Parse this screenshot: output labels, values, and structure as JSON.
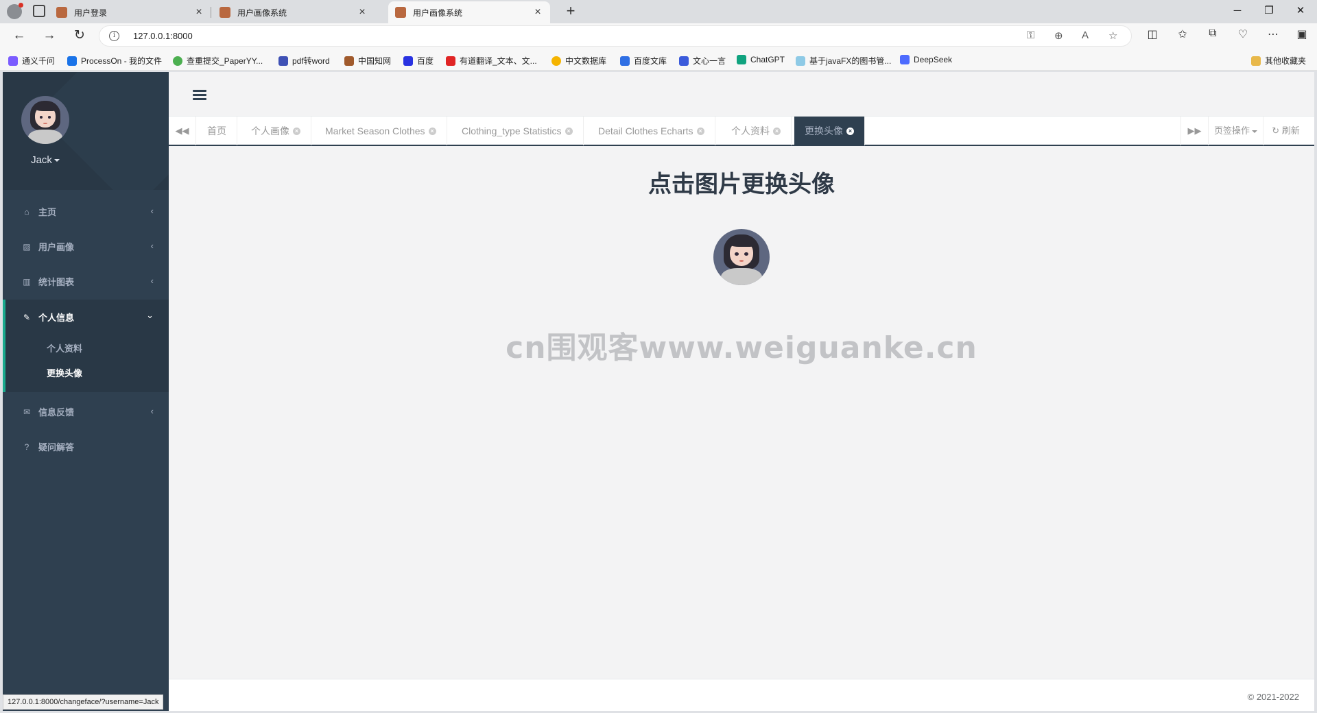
{
  "browser": {
    "tabs": [
      {
        "title": "用户登录",
        "active": false
      },
      {
        "title": "用户画像系统",
        "active": false
      },
      {
        "title": "用户画像系统",
        "active": true
      }
    ],
    "url": "127.0.0.1:8000",
    "bookmarks": [
      {
        "label": "通义千问",
        "color": "#7b5cff"
      },
      {
        "label": "ProcessOn - 我的文件",
        "color": "#1a73e8"
      },
      {
        "label": "查重提交_PaperYY...",
        "color": "#4caf50"
      },
      {
        "label": "pdf转word",
        "color": "#3f51b5"
      },
      {
        "label": "中国知网",
        "color": "#a05a2c"
      },
      {
        "label": "百度",
        "color": "#2932e1"
      },
      {
        "label": "有道翻译_文本、文...",
        "color": "#e02424"
      },
      {
        "label": "中文数据库",
        "color": "#f5b400"
      },
      {
        "label": "百度文库",
        "color": "#2f6fe4"
      },
      {
        "label": "文心一言",
        "color": "#3b5bdb"
      },
      {
        "label": "ChatGPT",
        "color": "#10a37f"
      },
      {
        "label": "基于javaFX的图书管...",
        "color": "#8ecae6"
      },
      {
        "label": "DeepSeek",
        "color": "#4d6bfe"
      },
      {
        "label": "其他收藏夹",
        "color": "#e8b84a"
      }
    ],
    "status_url": "127.0.0.1:8000/changeface/?username=Jack"
  },
  "sidebar": {
    "username": "Jack",
    "menu": [
      {
        "label": "主页",
        "icon": "home-icon"
      },
      {
        "label": "用户画像",
        "icon": "picture-icon"
      },
      {
        "label": "统计图表",
        "icon": "bar-chart-icon"
      },
      {
        "label": "个人信息",
        "icon": "edit-icon",
        "expanded": true
      },
      {
        "label": "信息反馈",
        "icon": "envelope-icon"
      },
      {
        "label": "疑问解答",
        "icon": "question-icon"
      }
    ],
    "submenu": [
      {
        "label": "个人资料",
        "active": false
      },
      {
        "label": "更换头像",
        "active": true
      }
    ]
  },
  "page_tabs": [
    {
      "label": "首页",
      "closable": false
    },
    {
      "label": "个人画像",
      "closable": true
    },
    {
      "label": "Market Season Clothes",
      "closable": true
    },
    {
      "label": "Clothing_type Statistics",
      "closable": true
    },
    {
      "label": "Detail Clothes Echarts",
      "closable": true
    },
    {
      "label": "个人资料",
      "closable": true
    },
    {
      "label": "更换头像",
      "closable": true,
      "active": true
    }
  ],
  "tab_actions": {
    "options": "页签操作",
    "refresh": "刷新"
  },
  "content": {
    "heading": "点击图片更换头像",
    "watermark": "cn围观客www.weiguanke.cn"
  },
  "footer": {
    "copyright": "© 2021-2022"
  },
  "colors": {
    "sidebar": "#2f4050",
    "accent": "#19aa8d",
    "background": "#f3f3f4"
  }
}
